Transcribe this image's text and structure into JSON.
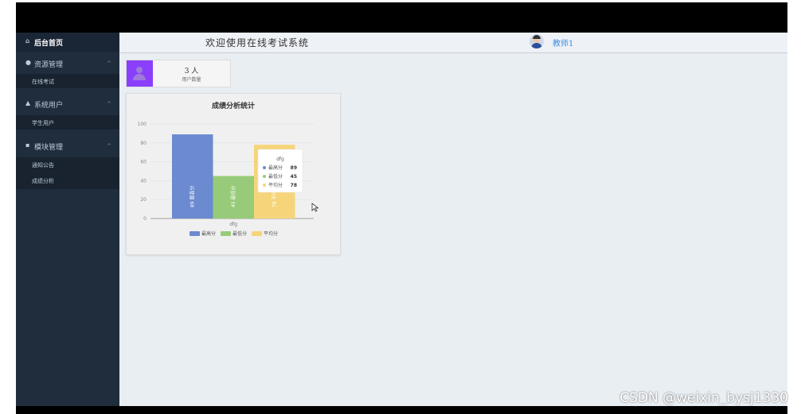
{
  "header": {
    "title": "欢迎使用在线考试系统",
    "username": "教师1"
  },
  "sidebar": {
    "home": {
      "label": "后台首页",
      "icon": "home-icon"
    },
    "groups": [
      {
        "label": "资源管理",
        "icon": "location-icon",
        "items": [
          {
            "label": "在线考试"
          }
        ]
      },
      {
        "label": "系统用户",
        "icon": "user-icon",
        "items": [
          {
            "label": "学生用户"
          }
        ]
      },
      {
        "label": "模块管理",
        "icon": "grid-icon",
        "items": [
          {
            "label": "通知公告"
          },
          {
            "label": "成绩分析"
          }
        ]
      }
    ]
  },
  "stat_card": {
    "count": "3 人",
    "label": "用户数量",
    "color": "#8a3ffc"
  },
  "chart_data": {
    "type": "bar",
    "title": "成绩分析统计",
    "categories": [
      "dfg"
    ],
    "series": [
      {
        "name": "最高分",
        "values": [
          89
        ],
        "color": "#6b8ad0"
      },
      {
        "name": "最低分",
        "values": [
          45
        ],
        "color": "#98cb79"
      },
      {
        "name": "平均分",
        "values": [
          78
        ],
        "color": "#f6d57a"
      }
    ],
    "ylim": [
      0,
      100
    ],
    "yticks": [
      0,
      20,
      40,
      60,
      80,
      100
    ],
    "grid": true,
    "legend": "bottom-center",
    "bar_labels": [
      "89 最高分",
      "45 最低分",
      "78 平均分"
    ],
    "tooltip": {
      "title": "dfg",
      "rows": [
        {
          "name": "最高分",
          "value": "89"
        },
        {
          "name": "最低分",
          "value": "45"
        },
        {
          "name": "平均分",
          "value": "78"
        }
      ]
    }
  },
  "watermark": "CSDN @weixin_bysj1330"
}
